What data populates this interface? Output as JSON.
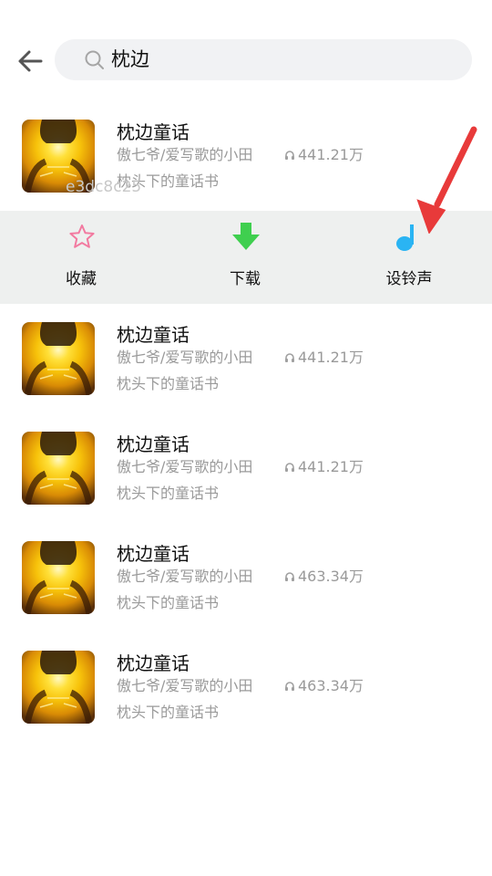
{
  "search": {
    "query": "枕边"
  },
  "watermark": "e3dc8c25",
  "songs": [
    {
      "title": "枕边童话",
      "artist": "傲七爷/爱写歌的小田",
      "plays": "441.21万",
      "album": "枕头下的童话书"
    },
    {
      "title": "枕边童话",
      "artist": "傲七爷/爱写歌的小田",
      "plays": "441.21万",
      "album": "枕头下的童话书"
    },
    {
      "title": "枕边童话",
      "artist": "傲七爷/爱写歌的小田",
      "plays": "441.21万",
      "album": "枕头下的童话书"
    },
    {
      "title": "枕边童话",
      "artist": "傲七爷/爱写歌的小田",
      "plays": "463.34万",
      "album": "枕头下的童话书"
    },
    {
      "title": "枕边童话",
      "artist": "傲七爷/爱写歌的小田",
      "plays": "463.34万",
      "album": "枕头下的童话书"
    }
  ],
  "actions": {
    "favorite": {
      "label": "收藏",
      "icon": "star-icon",
      "color": "#f27aa0"
    },
    "download": {
      "label": "下载",
      "icon": "download-arrow-icon",
      "color": "#3fcf4f"
    },
    "ringtone": {
      "label": "设铃声",
      "icon": "music-note-icon",
      "color": "#2ab4f3"
    }
  },
  "annotation": {
    "icon": "red-pointer-arrow",
    "color": "#e83a3a"
  }
}
